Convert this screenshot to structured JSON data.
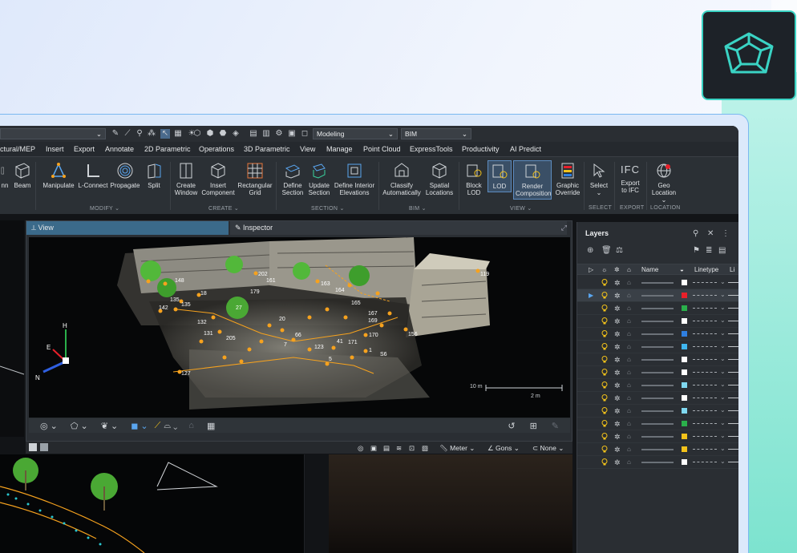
{
  "quick_access": {
    "workspace_value": "Modeling",
    "profile_value": "BIM"
  },
  "menu": [
    "ctural/MEP",
    "Insert",
    "Export",
    "Annotate",
    "2D Parametric",
    "Operations",
    "3D Parametric",
    "View",
    "Manage",
    "Point Cloud",
    "ExpressTools",
    "Productivity",
    "AI Predict"
  ],
  "ribbon": {
    "buttons": {
      "column": "nn",
      "beam": "Beam",
      "manipulate": "Manipulate",
      "l_connect": "L-Connect",
      "propagate": "Propagate",
      "split": "Split",
      "create_window": "Create\nWindow",
      "insert_component": "Insert\nComponent",
      "rectangular_grid": "Rectangular\nGrid",
      "define_section": "Define\nSection",
      "update_section": "Update\nSection",
      "define_interior": "Define Interior\nElevations",
      "classify": "Classify\nAutomatically",
      "spatial": "Spatial\nLocations",
      "block_lod": "Block\nLOD",
      "lod": "LOD",
      "render_comp": "Render\nComposition",
      "graphic_override": "Graphic\nOverride",
      "select": "Select",
      "export_ifc": "Export\nto IFC",
      "ifc_glyph": "IFC",
      "geo_location": "Geo\nLocation"
    },
    "groups": {
      "modify": "MODIFY",
      "create": "CREATE",
      "section": "SECTION",
      "bim": "BIM",
      "view": "VIEW",
      "select": "SELECT",
      "export": "EXPORT",
      "location": "LOCATION"
    }
  },
  "viewport": {
    "tab_view": "View",
    "tab_inspector": "Inspector",
    "scale_10m": "10 m",
    "scale_2m": "2 m",
    "axis_h": "H",
    "axis_e": "E",
    "axis_n": "N",
    "points": [
      "148",
      "18",
      "135",
      "135",
      "142",
      "132",
      "131",
      "205",
      "127",
      "202",
      "163",
      "164",
      "165",
      "167",
      "169",
      "170",
      "171",
      "156",
      "119",
      "66",
      "41",
      "123",
      "5",
      "S6",
      "1",
      "7",
      "27",
      "20",
      "161",
      "179"
    ]
  },
  "status": {
    "units": "Meter",
    "angle": "Gons",
    "snap": "None"
  },
  "layers": {
    "title": "Layers",
    "col_name": "Name",
    "col_linetype": "Linetype",
    "col_lineweight": "Li",
    "rows": [
      {
        "color": "#ffffff",
        "selected": false
      },
      {
        "color": "#e8202a",
        "selected": true
      },
      {
        "color": "#2ab04b",
        "selected": false
      },
      {
        "color": "#ffffff",
        "selected": false
      },
      {
        "color": "#2f7fe0",
        "selected": false
      },
      {
        "color": "#3fb6f0",
        "selected": false
      },
      {
        "color": "#ffffff",
        "selected": false
      },
      {
        "color": "#ffffff",
        "selected": false
      },
      {
        "color": "#7fd8f0",
        "selected": false
      },
      {
        "color": "#ffffff",
        "selected": false
      },
      {
        "color": "#7fd8f0",
        "selected": false
      },
      {
        "color": "#2ab04b",
        "selected": false
      },
      {
        "color": "#f3c21a",
        "selected": false
      },
      {
        "color": "#f3c21a",
        "selected": false
      },
      {
        "color": "#ffffff",
        "selected": false
      }
    ]
  },
  "colors": {
    "accent": "#3ad3c4",
    "point_marker": "#f6a21e",
    "tab_active": "#3b6a8a"
  }
}
